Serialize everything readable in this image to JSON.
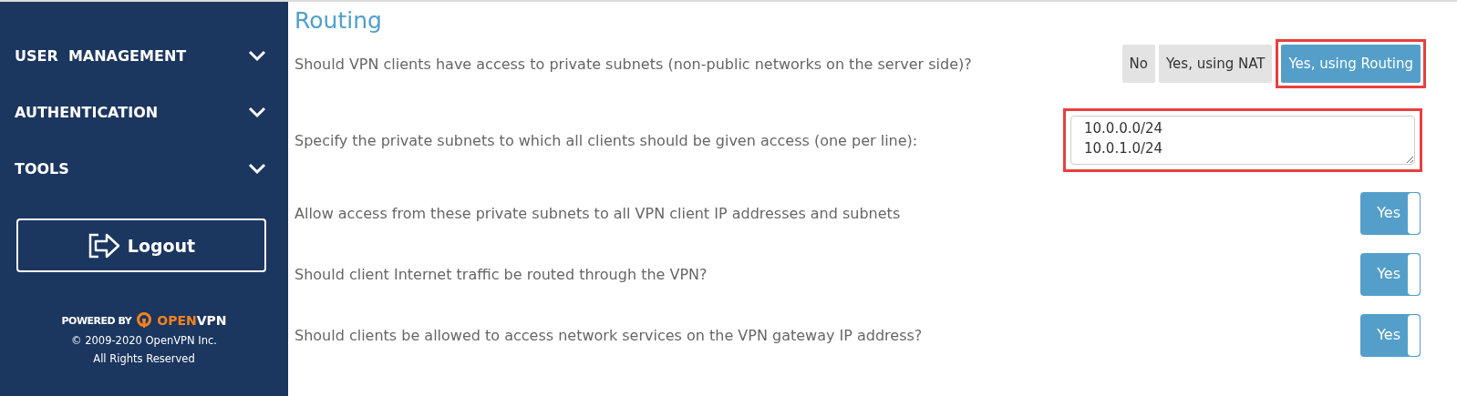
{
  "sidebar": {
    "items": [
      {
        "label": "USER  MANAGEMENT",
        "expanded": false
      },
      {
        "label": "AUTHENTICATION",
        "expanded": false
      },
      {
        "label": "TOOLS",
        "expanded": false
      }
    ],
    "logout": "Logout",
    "footer": {
      "powered_by": "POWERED BY",
      "brand_open": "OPEN",
      "brand_vpn": "VPN",
      "copyright": "© 2009-2020 OpenVPN Inc.",
      "rights": "All Rights Reserved"
    }
  },
  "section": {
    "title": "Routing",
    "settings": [
      {
        "kind": "choice",
        "label": "Should VPN clients have access to private subnets (non-public networks on the server side)?",
        "highlighted": true,
        "options": [
          {
            "label": "No",
            "selected": false
          },
          {
            "label": "Yes, using NAT",
            "selected": false
          },
          {
            "label": "Yes, using Routing",
            "selected": true
          }
        ]
      },
      {
        "kind": "textarea",
        "label": "Specify the private subnets to which all clients should be given access (one per line):",
        "highlighted": true,
        "value": "10.0.0.0/24\n10.0.1.0/24"
      },
      {
        "kind": "toggle",
        "label": "Allow access from these private subnets to all VPN client IP addresses and subnets",
        "on": true,
        "value": "Yes"
      },
      {
        "kind": "toggle",
        "label": "Should client Internet traffic be routed through the VPN?",
        "on": true,
        "value": "Yes"
      },
      {
        "kind": "toggle",
        "label": "Should clients be allowed to access network services on the VPN gateway IP address?",
        "on": true,
        "value": "Yes"
      }
    ]
  }
}
